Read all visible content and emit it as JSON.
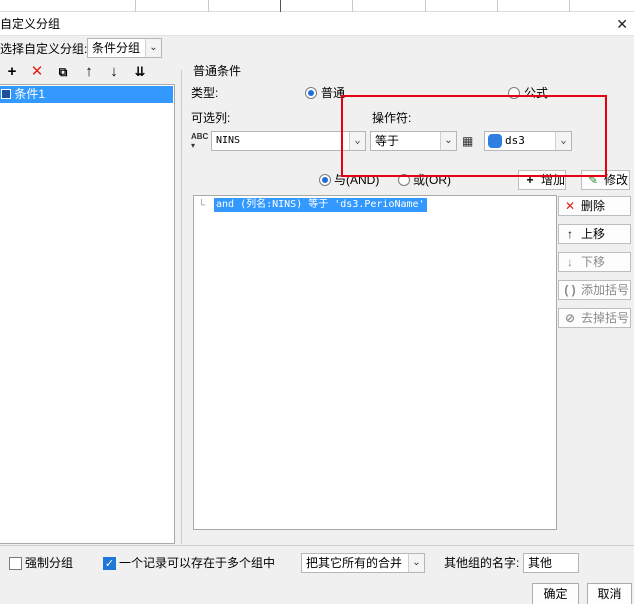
{
  "window": {
    "title": "自定义分组"
  },
  "group_select": {
    "label": "选择自定义分组:",
    "value": "条件分组"
  },
  "tree": {
    "items": [
      {
        "label": "条件1"
      }
    ]
  },
  "condition": {
    "section_title": "普通条件",
    "type_label": "类型:",
    "type_options": {
      "normal": "普通",
      "formula": "公式"
    },
    "column_label": "可选列:",
    "column_value": "NINS",
    "operator_label": "操作符:",
    "operator_value": "等于",
    "dataset_value": "ds3",
    "logic": {
      "and_label": "与(AND)",
      "or_label": "或(OR)"
    },
    "add_label": "增加",
    "modify_label": "修改",
    "expression": "and (列名:NINS) 等于 'ds3.PerioName'"
  },
  "side_buttons": {
    "delete": "删除",
    "move_up": "上移",
    "move_down": "下移",
    "add_paren": "添加括号",
    "remove_paren": "去掉括号"
  },
  "footer": {
    "force_group": "强制分组",
    "multi_group": "一个记录可以存在于多个组中",
    "merge_option": "把其它所有的合并",
    "other_name_label": "其他组的名字:",
    "other_name_value": "其他",
    "ok": "确定",
    "cancel": "取消"
  },
  "colors": {
    "highlight": "#3399ff",
    "annotation": "#e60012",
    "accent": "#1e78d7"
  }
}
